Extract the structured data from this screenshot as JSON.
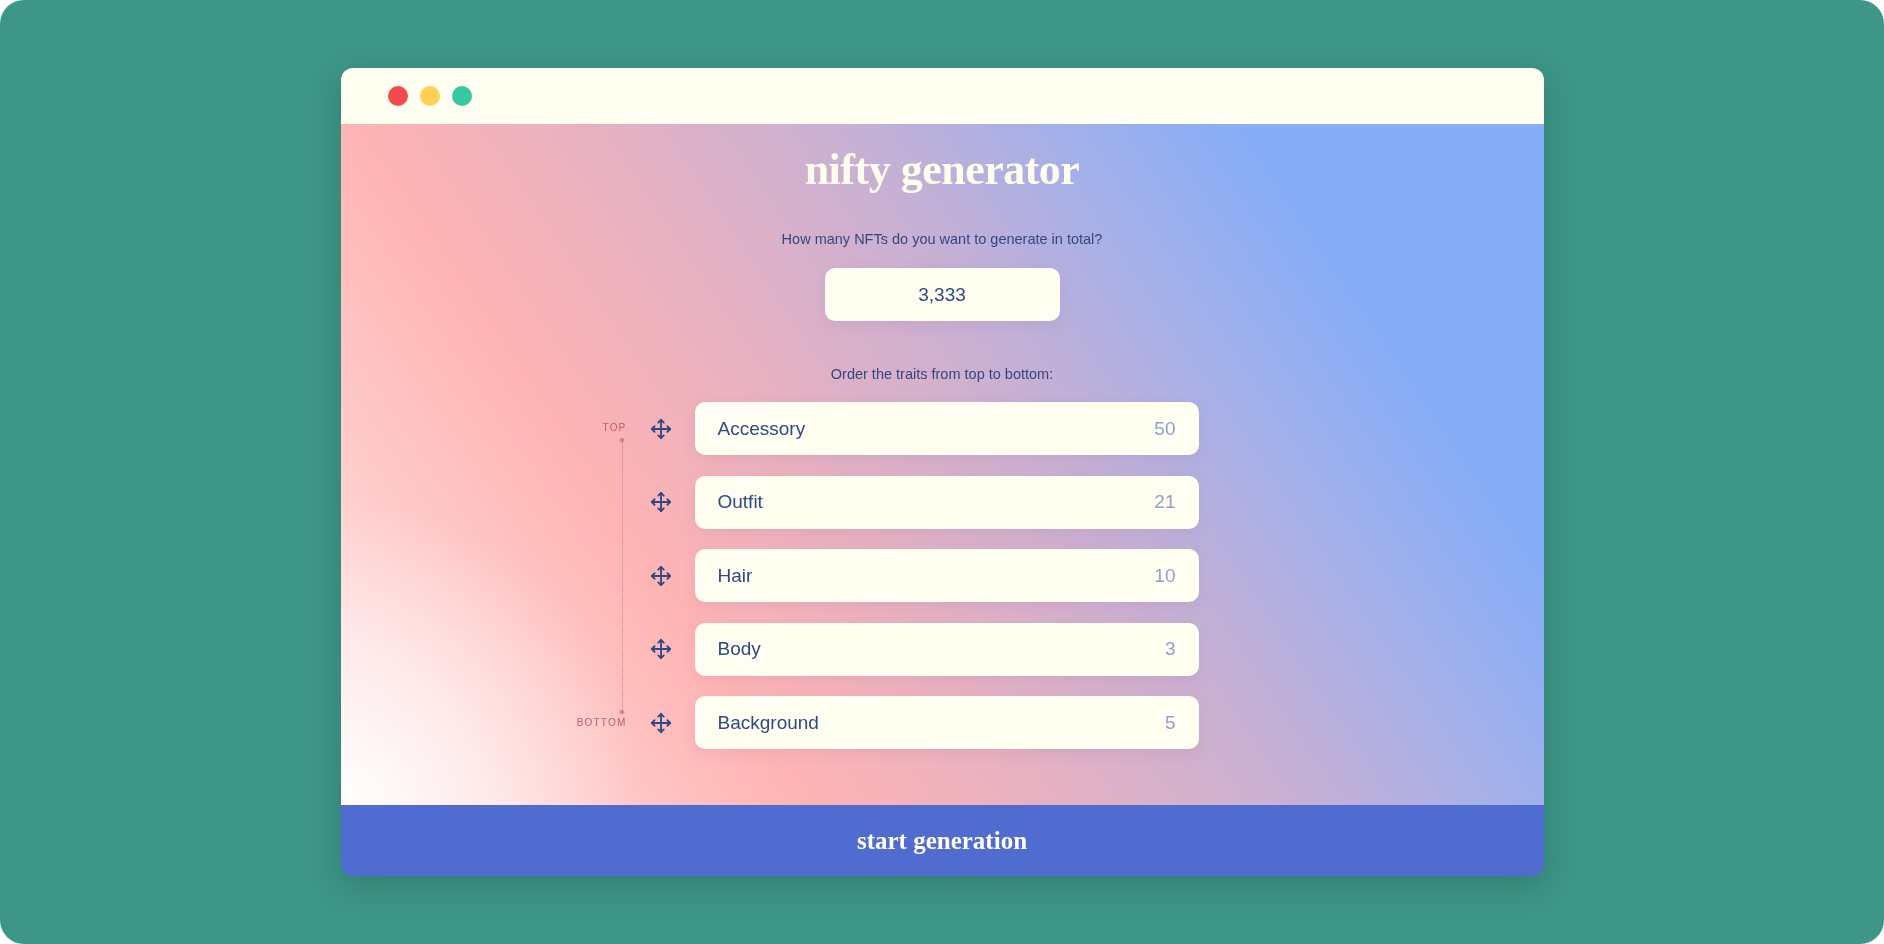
{
  "window_controls": [
    {
      "color": "#f24b4b"
    },
    {
      "color": "#ffd052"
    },
    {
      "color": "#36c99f"
    }
  ],
  "title": "nifty generator",
  "total": {
    "label": "How many NFTs do you want to generate in total?",
    "value": "3,333"
  },
  "traits": {
    "label": "Order the traits from top to bottom:",
    "top_label": "TOP",
    "bottom_label": "BOTTOM",
    "items": [
      {
        "name": "Accessory",
        "count": "50"
      },
      {
        "name": "Outfit",
        "count": "21"
      },
      {
        "name": "Hair",
        "count": "10"
      },
      {
        "name": "Body",
        "count": "3"
      },
      {
        "name": "Background",
        "count": "5"
      }
    ]
  },
  "start_button": {
    "label": "start generation"
  }
}
